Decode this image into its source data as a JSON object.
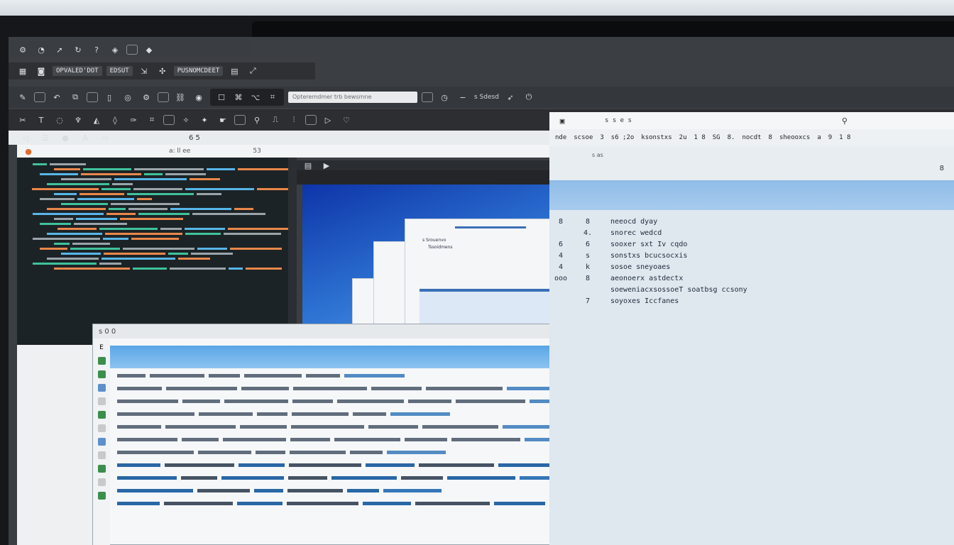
{
  "toolbar": {
    "tab1": "OPVALED'DOT",
    "tab2": "EDSUT",
    "tab3": "PUSNOMCDEET",
    "search_placeholder": "Opteremdmer trb bewsmne",
    "indicator": "6 5",
    "zoom": "s Sdesd"
  },
  "editor": {
    "header_left": "a: ll ee",
    "header_mid": "53"
  },
  "preview": {
    "title": "s Srouenvo",
    "subtitle": "Tssoidmens"
  },
  "right_panel": {
    "top_label": "s s e s",
    "header_cells": [
      "nde",
      "scsoe",
      "3",
      "s6 ;2o",
      "ksonstxs",
      "2u",
      "1 8",
      "SG",
      "8.",
      "nocdt",
      "8",
      "sheooxcs",
      "a",
      "9",
      "1 8"
    ],
    "sub_label": "s as",
    "sub_count": "8",
    "items": [
      {
        "a": "8",
        "b": "8",
        "text": "neeocd dyay"
      },
      {
        "a": "",
        "b": "4.",
        "text": "snorec wedcd"
      },
      {
        "a": "6",
        "b": "6",
        "text": "sooxer sxt Iv cqdo"
      },
      {
        "a": "4",
        "b": "s",
        "text": "sonstxs bcucsocxis"
      },
      {
        "a": "4",
        "b": "k",
        "text": "sosoe sneyoaes"
      },
      {
        "a": "ooo",
        "b": "8",
        "text": "aeonoerx astdectx"
      },
      {
        "a": "",
        "b": "",
        "text": "soeweniacxsossoeT soatbsg ccsony"
      },
      {
        "a": "",
        "b": "7",
        "text": "soyoxes Iccfanes"
      }
    ]
  },
  "table_window": {
    "title": "s 0 0",
    "side_label": "E"
  }
}
